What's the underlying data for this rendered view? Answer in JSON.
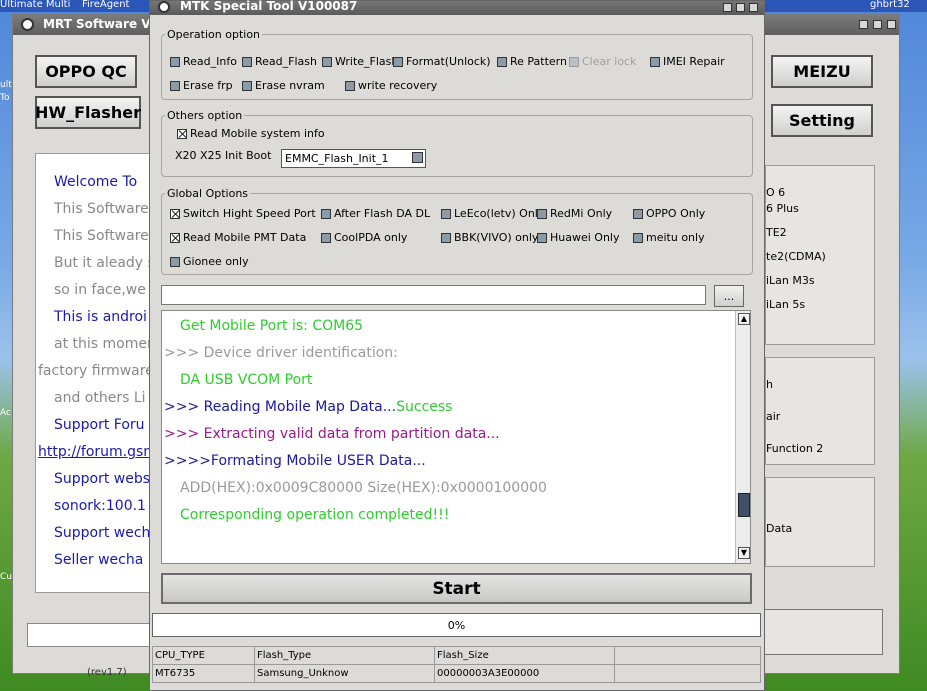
{
  "desktop": {
    "top_labels": [
      "Ultimate Multi",
      "FireAgent",
      "ghbrt32"
    ],
    "left_labels": [
      "ult",
      "To",
      "Ac",
      "Cus"
    ]
  },
  "mrt_window": {
    "title": "MRT Software V",
    "oppo_qc_label": "OPPO QC",
    "hw_flasher_label": "HW_Flasher",
    "meizu_label": "MEIZU",
    "setting_label": "Setting",
    "version_label": "(rev1.7)",
    "welcome_lines": [
      {
        "text": "Welcome To",
        "color": "#1a1aa8"
      },
      {
        "text": "This Software",
        "color": "#888888"
      },
      {
        "text": "This Software",
        "color": "#888888"
      },
      {
        "text": "But it aleady s",
        "color": "#888888"
      },
      {
        "text": "so in face,we",
        "color": "#888888"
      },
      {
        "text": "This is androi",
        "color": "#1a1aa8"
      },
      {
        "text": "at this momer",
        "color": "#888888"
      },
      {
        "text": "factory firmware",
        "color": "#888888"
      },
      {
        "text": "and others Li",
        "color": "#888888"
      },
      {
        "text": "Support Foru",
        "color": "#1a1aa8"
      },
      {
        "text": "http://forum.gsm",
        "color": "#1a1aa8",
        "underline": true
      },
      {
        "text": "Support webs",
        "color": "#1a1aa8"
      },
      {
        "text": "sonork:100.1",
        "color": "#1a1aa8"
      },
      {
        "text": "Support wech",
        "color": "#1a1aa8"
      },
      {
        "text": "Seller wecha",
        "color": "#1a1aa8"
      }
    ],
    "right_panel_1": [
      "O 6",
      "6 Plus",
      "TE2",
      "te2(CDMA)",
      "iLan M3s",
      "iLan 5s"
    ],
    "right_panel_2": [
      "h",
      "air",
      "Function 2"
    ],
    "right_panel_3": [
      "Data"
    ]
  },
  "mtk_window": {
    "title": "MTK Special Tool V100087",
    "operation_option": {
      "legend": "Operation option",
      "items": [
        {
          "label": "Read_Info",
          "checked": false,
          "disabled": false
        },
        {
          "label": "Read_Flash",
          "checked": false,
          "disabled": false
        },
        {
          "label": "Write_Flash",
          "checked": false,
          "disabled": false
        },
        {
          "label": "Format(Unlock)",
          "checked": false,
          "disabled": false
        },
        {
          "label": "Re Pattern l",
          "checked": false,
          "disabled": false
        },
        {
          "label": "Clear lock",
          "checked": false,
          "disabled": true
        },
        {
          "label": "IMEI Repair",
          "checked": false,
          "disabled": false
        },
        {
          "label": "Erase frp",
          "checked": false,
          "disabled": false
        },
        {
          "label": "Erase nvram",
          "checked": false,
          "disabled": false
        },
        {
          "label": "write recovery",
          "checked": false,
          "disabled": false
        }
      ]
    },
    "others_option": {
      "legend": "Others option",
      "read_mobile_system_info": {
        "label": "Read Mobile system info",
        "checked": true
      },
      "init_boot_label": "X20 X25 Init Boot",
      "init_boot_value": "EMMC_Flash_Init_1"
    },
    "global_options": {
      "legend": "Global Options",
      "items": [
        {
          "label": "Switch Hight Speed Port",
          "checked": true
        },
        {
          "label": "After Flash DA DL",
          "checked": false
        },
        {
          "label": "LeEco(letv) Only",
          "checked": false
        },
        {
          "label": "RedMi Only",
          "checked": false
        },
        {
          "label": "OPPO Only",
          "checked": false
        },
        {
          "label": "Read Mobile PMT Data",
          "checked": true
        },
        {
          "label": "CoolPDA only",
          "checked": false
        },
        {
          "label": "BBK(VIVO) only",
          "checked": false
        },
        {
          "label": "Huawei Only",
          "checked": false
        },
        {
          "label": "meitu only",
          "checked": false
        },
        {
          "label": "Gionee only",
          "checked": false
        }
      ]
    },
    "file_path_value": "",
    "browse_label": "...",
    "log_lines": [
      {
        "text": "Get Mobile Port is:  COM65",
        "color": "#2ecc2e",
        "indent": true
      },
      {
        "text": ">>> Device driver identification:",
        "color": "#9a9a9a",
        "indent": false
      },
      {
        "text": "DA USB VCOM Port",
        "color": "#2ecc2e",
        "indent": true
      },
      {
        "text": ">>> Reading Mobile Map Data...",
        "suffix": "Success",
        "color": "#1a1a9a",
        "suffix_color": "#2ecc2e",
        "indent": false
      },
      {
        "text": ">>> Extracting valid data from partition data...",
        "color": "#9a1a8a",
        "indent": false
      },
      {
        "text": ">>>>Formating Mobile USER Data...",
        "color": "#1a1a9a",
        "indent": false
      },
      {
        "text": "ADD(HEX):0x0009C80000    Size(HEX):0x0000100000",
        "color": "#9a9a9a",
        "indent": true
      },
      {
        "text": "Corresponding operation completed!!!",
        "color": "#2ecc2e",
        "indent": true
      }
    ],
    "start_label": "Start",
    "progress_text": "0%",
    "progress": 0,
    "info_table": {
      "headers": [
        "CPU_TYPE",
        "Flash_Type",
        "Flash_Size",
        ""
      ],
      "values": [
        "MT6735",
        "Samsung_Unknow",
        "00000003A3E00000",
        ""
      ]
    }
  },
  "colors": {
    "window_bg": "#dcdbd8",
    "title_bar": "#6a6a6a",
    "log_green": "#2ecc2e",
    "log_blue": "#1a1a9a",
    "log_purple": "#9a1a8a",
    "log_gray": "#9a9a9a"
  }
}
